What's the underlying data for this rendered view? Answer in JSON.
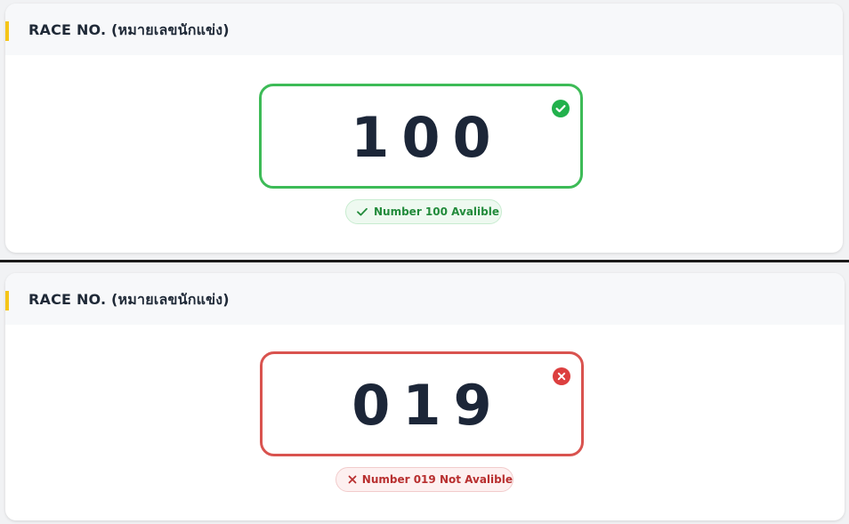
{
  "sections": [
    {
      "title": "RACE NO. (หมายเลขนักแข่ง)",
      "race_number": "100",
      "status": "available",
      "status_icon": "check-circle-icon",
      "status_color": "#22b14c",
      "message": "Number 100 Avalible",
      "message_icon": "check-icon"
    },
    {
      "title": "RACE NO. (หมายเลขนักแข่ง)",
      "race_number": "019",
      "status": "unavailable",
      "status_icon": "x-circle-icon",
      "status_color": "#dc3f3f",
      "message": "Number 019 Not Avalible",
      "message_icon": "x-icon"
    }
  ],
  "colors": {
    "accent": "#f5c518",
    "success": "#3dbb57",
    "error": "#d9534f",
    "number_text": "#1c2638"
  }
}
